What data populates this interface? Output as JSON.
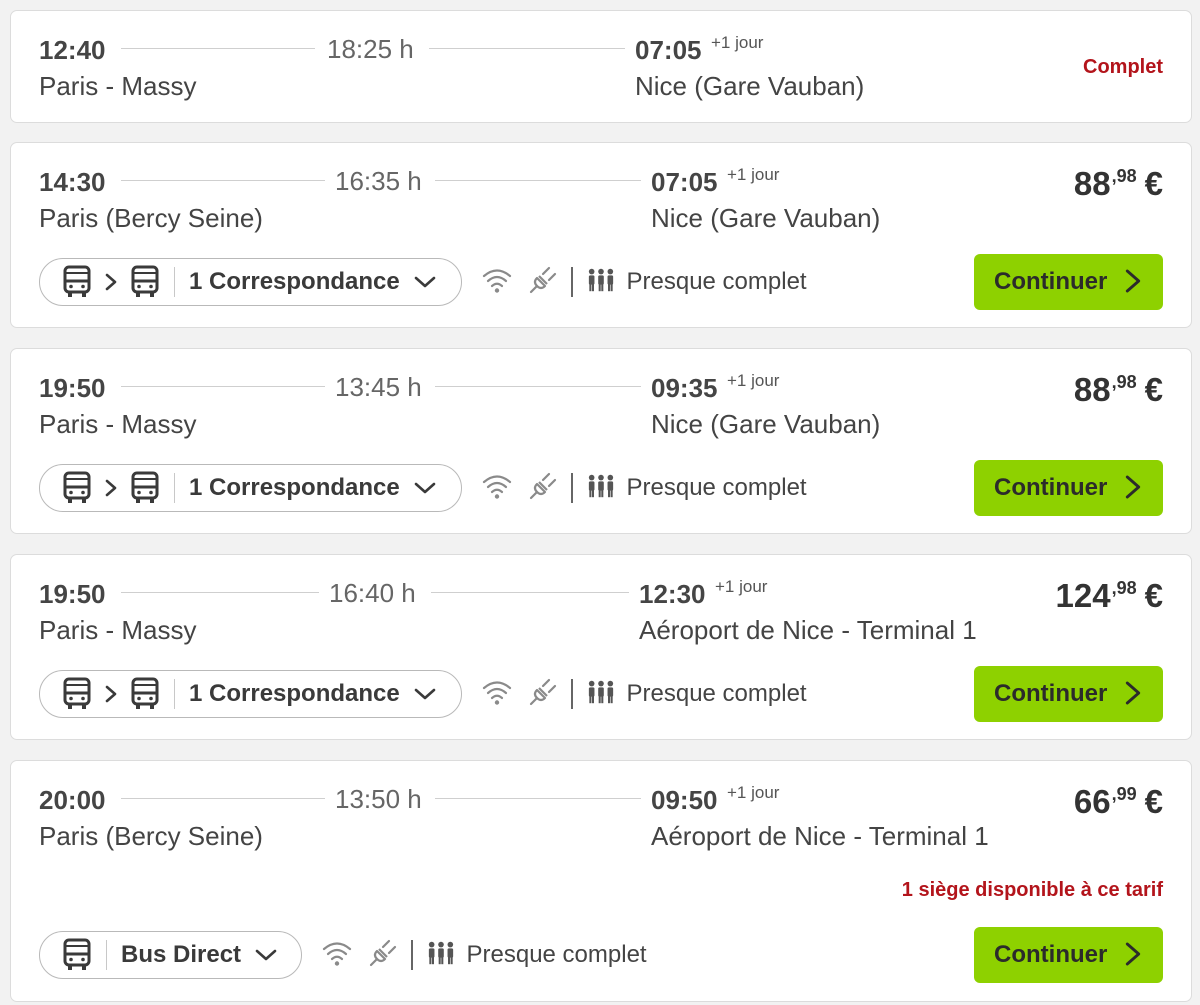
{
  "results": [
    {
      "dep_time": "12:40",
      "duration": "18:25 h",
      "arr_time": "07:05",
      "next_day": "+1 jour",
      "from": "Paris - Massy",
      "to": "Nice (Gare Vauban)",
      "status": "Complet"
    },
    {
      "dep_time": "14:30",
      "duration": "16:35 h",
      "arr_time": "07:05",
      "next_day": "+1 jour",
      "from": "Paris (Bercy Seine)",
      "to": "Nice (Gare Vauban)",
      "price_int": "88",
      "price_dec": ",98",
      "currency": "€",
      "connection_label": "1 Correspondance",
      "occupancy": "Presque complet",
      "cta": "Continuer"
    },
    {
      "dep_time": "19:50",
      "duration": "13:45 h",
      "arr_time": "09:35",
      "next_day": "+1 jour",
      "from": "Paris - Massy",
      "to": "Nice (Gare Vauban)",
      "price_int": "88",
      "price_dec": ",98",
      "currency": "€",
      "connection_label": "1 Correspondance",
      "occupancy": "Presque complet",
      "cta": "Continuer"
    },
    {
      "dep_time": "19:50",
      "duration": "16:40 h",
      "arr_time": "12:30",
      "next_day": "+1 jour",
      "from": "Paris - Massy",
      "to": "Aéroport de Nice - Terminal 1",
      "price_int": "124",
      "price_dec": ",98",
      "currency": "€",
      "connection_label": "1 Correspondance",
      "occupancy": "Presque complet",
      "cta": "Continuer"
    },
    {
      "dep_time": "20:00",
      "duration": "13:50 h",
      "arr_time": "09:50",
      "next_day": "+1 jour",
      "from": "Paris (Bercy Seine)",
      "to": "Aéroport de Nice - Terminal 1",
      "price_int": "66",
      "price_dec": ",99",
      "currency": "€",
      "seat_notice": "1 siège disponible à ce tarif",
      "connection_label": "Bus Direct",
      "occupancy": "Presque complet",
      "cta": "Continuer"
    }
  ],
  "colors": {
    "accent_green": "#8ed100",
    "alert_red": "#b3141b"
  },
  "icons": [
    "bus-icon",
    "chevron-right-icon",
    "chevron-down-icon",
    "wifi-icon",
    "power-plug-icon",
    "passengers-icon"
  ]
}
